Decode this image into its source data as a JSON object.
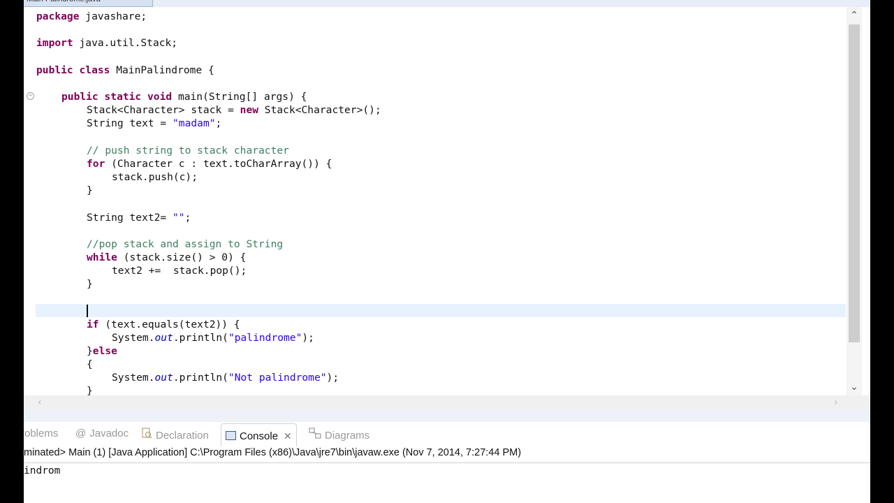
{
  "editor": {
    "tab_label": "Main Palindrome.java",
    "lines": [
      {
        "y": 0,
        "parts": [
          [
            "kw",
            "package"
          ],
          [
            "",
            "javashare;"
          ]
        ],
        "indent": 0,
        "sep": " "
      },
      {
        "y": 38,
        "parts": [
          [
            "kw",
            "import"
          ],
          [
            "",
            "java.util.Stack;"
          ]
        ],
        "indent": 0,
        "sep": " "
      },
      {
        "y": 77,
        "parts": [
          [
            "kw",
            "public class"
          ],
          [
            "",
            "MainPalindrome {"
          ]
        ],
        "indent": 0,
        "sep": " "
      }
    ],
    "code": {
      "l1_kw": "package",
      "l1_rest": " javashare;",
      "l2_kw": "import",
      "l2_rest": " java.util.Stack;",
      "l3_kw": "public class",
      "l3_rest": " MainPalindrome {",
      "l4_kw": "public static void",
      "l4_rest": " main(String[] args) {",
      "l5_a": "Stack<Character> stack = ",
      "l5_kw": "new",
      "l5_b": " Stack<Character>();",
      "l6_a": "String text = ",
      "l6_str": "\"madam\"",
      "l6_b": ";",
      "l7_cm": "// push string to stack character",
      "l8_kw": "for",
      "l8_rest": " (Character c : text.toCharArray()) {",
      "l9": "stack.push(c);",
      "l10": "}",
      "l11_a": "String text2= ",
      "l11_str": "\"\"",
      "l11_b": ";",
      "l12_cm": "//pop stack and assign to String",
      "l13_kw": "while",
      "l13_rest": " (stack.size() > 0) {",
      "l14": "text2 +=  stack.pop();",
      "l15": "}",
      "l16_kw": "if",
      "l16_rest": " (text.equals(text2)) {",
      "l17_a": "System.",
      "l17_it": "out",
      "l17_b": ".println(",
      "l17_str": "\"palindrome\"",
      "l17_c": ");",
      "l18_a": "}",
      "l18_kw": "else",
      "l19": "{",
      "l20_a": "System.",
      "l20_it": "out",
      "l20_b": ".println(",
      "l20_str": "\"Not palindrome\"",
      "l20_c": ");",
      "l21": "}"
    }
  },
  "panel": {
    "tabs": {
      "problems": "roblems",
      "javadoc_icon": "@",
      "javadoc": "Javadoc",
      "declaration": "Declaration",
      "console": "Console",
      "console_close": "✕",
      "diagrams": "Diagrams"
    },
    "console_header": "minated> Main (1) [Java Application] C:\\Program Files (x86)\\Java\\jre7\\bin\\javaw.exe (Nov 7, 2014, 7:27:44 PM)",
    "console_output": "indrom"
  },
  "icons": {
    "fold": "minus-circle-icon",
    "javadoc": "at-icon",
    "declaration": "declaration-icon",
    "console": "console-icon",
    "diagrams": "diagrams-icon"
  }
}
